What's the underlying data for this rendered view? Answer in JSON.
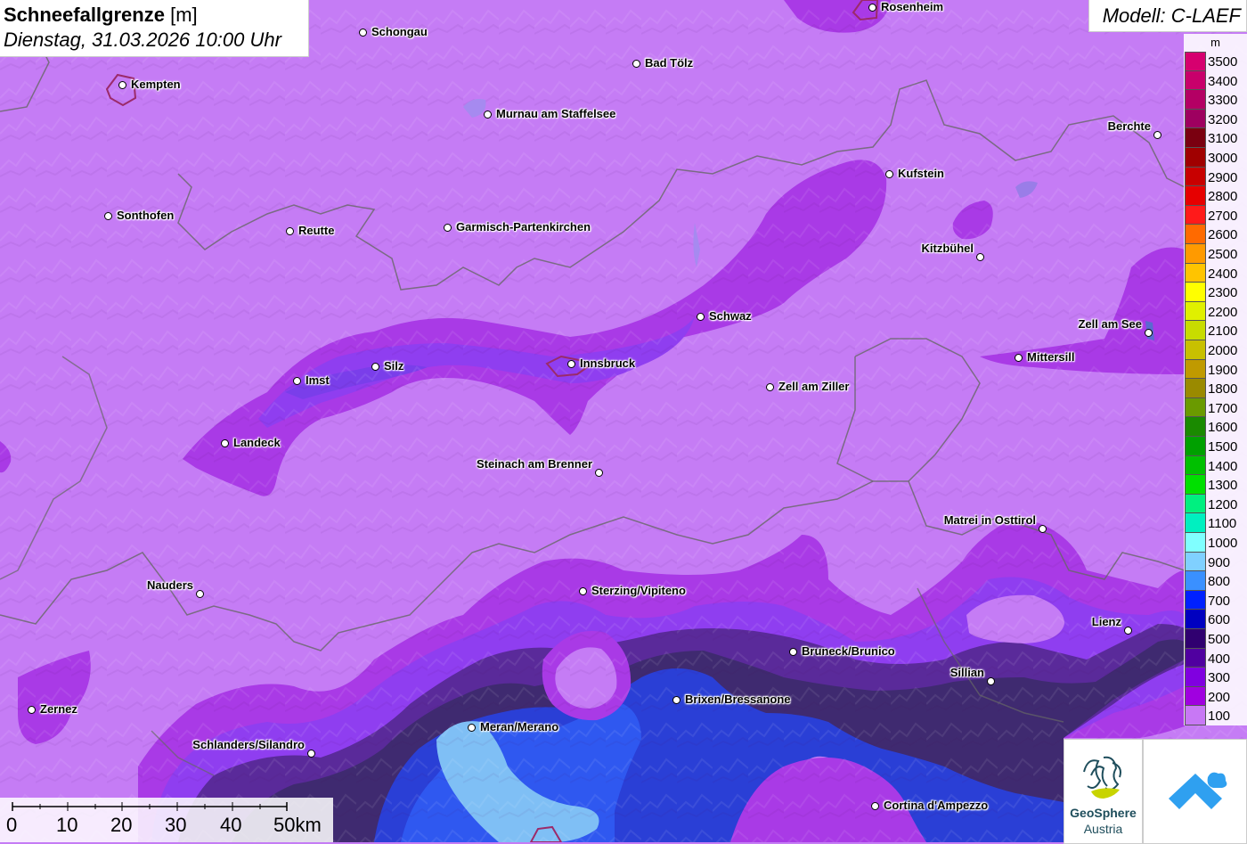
{
  "title": {
    "name": "Schneefallgrenze",
    "unit": "[m]",
    "datetime": "Dienstag, 31.03.2026 10:00 Uhr"
  },
  "model": "Modell: C-LAEF",
  "legend": {
    "unit": "m",
    "classes": [
      {
        "label": "3500",
        "color": "#d6006f"
      },
      {
        "label": "3400",
        "color": "#c8006b"
      },
      {
        "label": "3300",
        "color": "#b40064"
      },
      {
        "label": "3200",
        "color": "#9e0060"
      },
      {
        "label": "3100",
        "color": "#7a0010"
      },
      {
        "label": "3000",
        "color": "#a00000"
      },
      {
        "label": "2900",
        "color": "#c80000"
      },
      {
        "label": "2800",
        "color": "#e60000"
      },
      {
        "label": "2700",
        "color": "#ff1a1a"
      },
      {
        "label": "2600",
        "color": "#ff6a00"
      },
      {
        "label": "2500",
        "color": "#ff9a00"
      },
      {
        "label": "2400",
        "color": "#ffc400"
      },
      {
        "label": "2300",
        "color": "#ffff00"
      },
      {
        "label": "2200",
        "color": "#e0f000"
      },
      {
        "label": "2100",
        "color": "#c8dc00"
      },
      {
        "label": "2000",
        "color": "#c8c000"
      },
      {
        "label": "1900",
        "color": "#c09a00"
      },
      {
        "label": "1800",
        "color": "#9a8a00"
      },
      {
        "label": "1700",
        "color": "#6a9a00"
      },
      {
        "label": "1600",
        "color": "#1a8a00"
      },
      {
        "label": "1500",
        "color": "#00a000"
      },
      {
        "label": "1400",
        "color": "#00c000"
      },
      {
        "label": "1300",
        "color": "#00e000"
      },
      {
        "label": "1200",
        "color": "#00f080"
      },
      {
        "label": "1100",
        "color": "#00f0c0"
      },
      {
        "label": "1000",
        "color": "#80ffff"
      },
      {
        "label": "900",
        "color": "#80d0ff"
      },
      {
        "label": "800",
        "color": "#3a90ff"
      },
      {
        "label": "700",
        "color": "#0020ff"
      },
      {
        "label": "600",
        "color": "#0000c0"
      },
      {
        "label": "500",
        "color": "#300070"
      },
      {
        "label": "400",
        "color": "#5000a0"
      },
      {
        "label": "300",
        "color": "#8000e0"
      },
      {
        "label": "200",
        "color": "#a000e0"
      },
      {
        "label": "100",
        "color": "#c878f5"
      }
    ]
  },
  "cities": [
    {
      "name": "Rosenheim"
    },
    {
      "name": "Schongau"
    },
    {
      "name": "Bad Tölz"
    },
    {
      "name": "Kempten"
    },
    {
      "name": "Murnau am Staffelsee"
    },
    {
      "name": "Berchte"
    },
    {
      "name": "Kufstein"
    },
    {
      "name": "Sonthofen"
    },
    {
      "name": "Reutte"
    },
    {
      "name": "Garmisch-Partenkirchen"
    },
    {
      "name": "Kitzbühel"
    },
    {
      "name": "Schwaz"
    },
    {
      "name": "Zell am See"
    },
    {
      "name": "Mittersill"
    },
    {
      "name": "Imst"
    },
    {
      "name": "Silz"
    },
    {
      "name": "Innsbruck"
    },
    {
      "name": "Zell am Ziller"
    },
    {
      "name": "Landeck"
    },
    {
      "name": "Steinach am Brenner"
    },
    {
      "name": "Matrei in Osttirol"
    },
    {
      "name": "Nauders"
    },
    {
      "name": "Sterzing/Vipiteno"
    },
    {
      "name": "Lienz"
    },
    {
      "name": "Bruneck/Brunico"
    },
    {
      "name": "Sillian"
    },
    {
      "name": "Brixen/Bressanone"
    },
    {
      "name": "Zernez"
    },
    {
      "name": "Meran/Merano"
    },
    {
      "name": "Schlanders/Silandro"
    },
    {
      "name": "Cortina d'Ampezzo"
    }
  ],
  "scale_bar": {
    "ticks": [
      "0",
      "10",
      "20",
      "30",
      "40",
      "50km"
    ]
  },
  "logos": {
    "geosphere_line1": "GeoSphere",
    "geosphere_line2": "Austria",
    "geosphere_color": "#1f4e5c",
    "second_logo_color": "#2fa0f0"
  }
}
